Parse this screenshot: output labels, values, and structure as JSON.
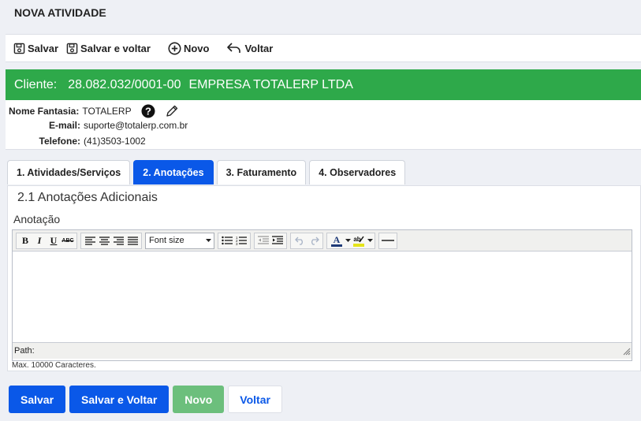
{
  "page": {
    "title": "NOVA ATIVIDADE"
  },
  "toolbar": {
    "save_label": "Salvar",
    "save_back_label": "Salvar e voltar",
    "new_label": "Novo",
    "back_label": "Voltar"
  },
  "client": {
    "label": "Cliente:",
    "cnpj": "28.082.032/0001-00",
    "name": "EMPRESA TOTALERP LTDA",
    "bar_color": "#2ea94a"
  },
  "info": {
    "fantasia_label": "Nome Fantasia:",
    "fantasia_value": "TOTALERP",
    "email_label": "E-mail:",
    "email_value": "suporte@totalerp.com.br",
    "phone_label": "Telefone:",
    "phone_value": "(41)3503-1002"
  },
  "tabs": [
    {
      "label": "1. Atividades/Serviços"
    },
    {
      "label": "2. Anotações"
    },
    {
      "label": "3. Faturamento"
    },
    {
      "label": "4. Observadores"
    }
  ],
  "section": {
    "title": "2.1 Anotações Adicionais",
    "field_label": "Anotação"
  },
  "editor": {
    "font_size_label": "Font size",
    "path_label": "Path:",
    "max_chars": "Max. 10000 Caracteres."
  },
  "footer": {
    "save_label": "Salvar",
    "save_back_label": "Salvar e Voltar",
    "new_label": "Novo",
    "back_label": "Voltar"
  },
  "colors": {
    "primary": "#0a58e8",
    "success": "#2ea94a"
  }
}
